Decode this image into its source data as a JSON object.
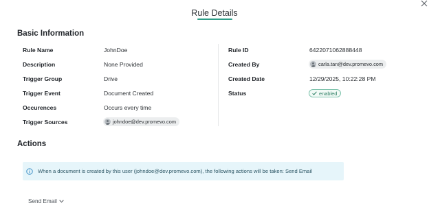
{
  "dialog": {
    "title": "Rule Details",
    "close_icon": "close-icon",
    "accent_color": "#2e9e88"
  },
  "basic_info": {
    "heading": "Basic Information",
    "left_fields": [
      {
        "label": "Rule Name",
        "value": "JohnDoe"
      },
      {
        "label": "Description",
        "value": "None Provided"
      },
      {
        "label": "Trigger Group",
        "value": "Drive"
      },
      {
        "label": "Trigger Event",
        "value": "Document Created"
      },
      {
        "label": "Occurences",
        "value": "Occurs every time"
      },
      {
        "label": "Trigger Sources",
        "value": "johndoe@dev.promevo.com",
        "type": "user-chip"
      }
    ],
    "right_fields": [
      {
        "label": "Rule ID",
        "value": "6422071062888448"
      },
      {
        "label": "Created By",
        "value": "carla.tan@dev.promevo.com",
        "type": "user-chip"
      },
      {
        "label": "Created Date",
        "value": "12/29/2025, 10:22:28 PM"
      },
      {
        "label": "Status",
        "value": "enabled",
        "type": "status-badge",
        "icon": "check-icon",
        "color": "#2a7d62"
      }
    ]
  },
  "actions": {
    "heading": "Actions",
    "info_icon": "info-icon",
    "info_text": "When a document is created by this user (johndoe@dev.promevo.com), the following actions will be taken: Send Email",
    "info_color": "#e6f5fa",
    "items": [
      {
        "label": "Send Email",
        "icon": "chevron-down-icon"
      }
    ]
  }
}
